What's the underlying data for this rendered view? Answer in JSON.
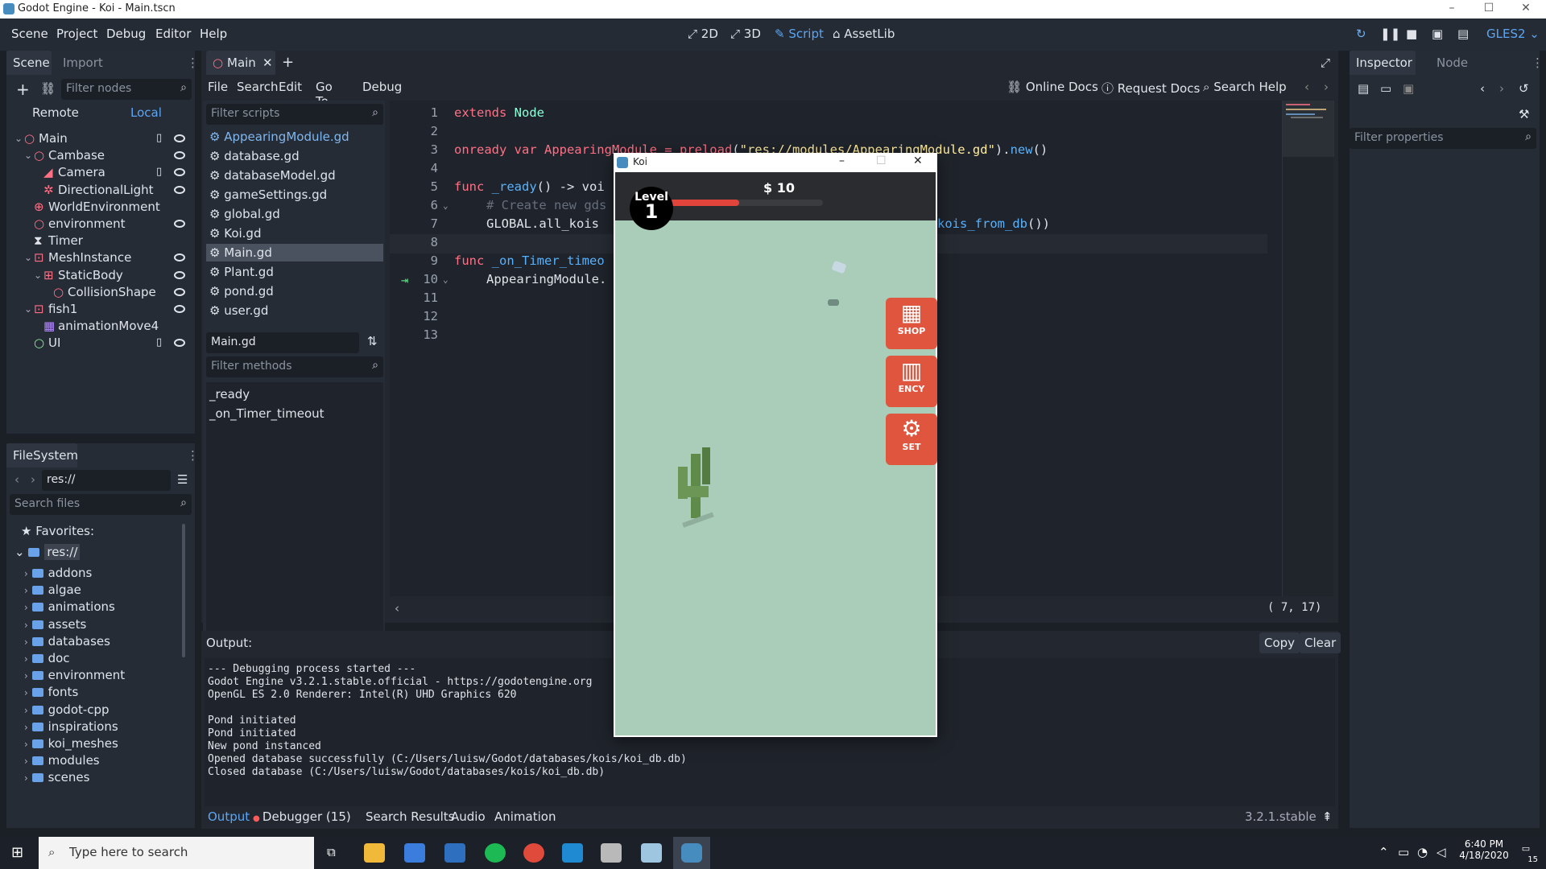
{
  "window": {
    "title": "Godot Engine - Koi - Main.tscn",
    "controls": [
      "–",
      "☐",
      "✕"
    ]
  },
  "menu": {
    "items": [
      "Scene",
      "Project",
      "Debug",
      "Editor",
      "Help"
    ]
  },
  "workspaces": {
    "2d": "2D",
    "3d": "3D",
    "script": "Script",
    "assetlib": "AssetLib"
  },
  "renderer": "GLES2",
  "scene_dock": {
    "tabs": [
      "Scene",
      "Import"
    ],
    "filter_placeholder": "Filter nodes",
    "remote": "Remote",
    "local": "Local",
    "nodes": [
      {
        "label": "Main",
        "depth": 0,
        "icon": "circle-red",
        "script": true,
        "eye": true
      },
      {
        "label": "Cambase",
        "depth": 1,
        "icon": "circle-red",
        "script": false,
        "eye": true
      },
      {
        "label": "Camera",
        "depth": 2,
        "icon": "camera-red",
        "script": true,
        "eye": true
      },
      {
        "label": "DirectionalLight",
        "depth": 2,
        "icon": "light-red",
        "script": false,
        "eye": true
      },
      {
        "label": "WorldEnvironment",
        "depth": 1,
        "icon": "globe-red",
        "script": false,
        "eye": false
      },
      {
        "label": "environment",
        "depth": 1,
        "icon": "circle-red",
        "script": false,
        "eye": true
      },
      {
        "label": "Timer",
        "depth": 1,
        "icon": "hourglass",
        "script": false,
        "eye": false
      },
      {
        "label": "MeshInstance",
        "depth": 1,
        "icon": "mesh-red",
        "script": false,
        "eye": true
      },
      {
        "label": "StaticBody",
        "depth": 2,
        "icon": "body-red",
        "script": false,
        "eye": true
      },
      {
        "label": "CollisionShape",
        "depth": 3,
        "icon": "circle-red",
        "script": false,
        "eye": true
      },
      {
        "label": "fish1",
        "depth": 1,
        "icon": "mesh-red",
        "script": false,
        "eye": true
      },
      {
        "label": "animationMove4",
        "depth": 2,
        "icon": "anim-purple",
        "script": false,
        "eye": false
      },
      {
        "label": "UI",
        "depth": 1,
        "icon": "circle-green",
        "script": true,
        "eye": true
      }
    ]
  },
  "filesystem": {
    "tab": "FileSystem",
    "path": "res://",
    "search_placeholder": "Search files",
    "favorites": "Favorites:",
    "root": "res://",
    "folders": [
      "addons",
      "algae",
      "animations",
      "assets",
      "databases",
      "doc",
      "environment",
      "fonts",
      "godot-cpp",
      "inspirations",
      "koi_meshes",
      "modules",
      "scenes"
    ]
  },
  "script_editor": {
    "tab": "Main",
    "menu": [
      "File",
      "Search",
      "Edit",
      "Go To",
      "Debug"
    ],
    "help_links": [
      "Online Docs",
      "Request Docs",
      "Search Help"
    ],
    "filter_scripts_placeholder": "Filter scripts",
    "scripts": [
      "AppearingModule.gd",
      "database.gd",
      "databaseModel.gd",
      "gameSettings.gd",
      "global.gd",
      "Koi.gd",
      "Main.gd",
      "Plant.gd",
      "pond.gd",
      "user.gd"
    ],
    "current_script": "Main.gd",
    "filter_methods_placeholder": "Filter methods",
    "methods": [
      "_ready",
      "_on_Timer_timeout"
    ],
    "line_numbers": [
      "1",
      "2",
      "3",
      "4",
      "5",
      "6",
      "7",
      "8",
      "9",
      "10",
      "11",
      "12",
      "13"
    ],
    "cursor": "(   7, 17)",
    "code": {
      "l1a": "extends ",
      "l1b": "Node",
      "l3a": "onready var AppearingModule = ",
      "l3b": "preload",
      "l3c": "(",
      "l3d": "\"res://modules/AppearingModule.gd\"",
      "l3e": ").",
      "l3f": "new",
      "l3g": "()",
      "l5a": "func ",
      "l5b": "_ready",
      "l5c": "() -> voi",
      "l6": "# Create new gds",
      "l7a": "GLOBAL.all_kois",
      "l7b": "kois_from_db",
      "l7c": "())",
      "l9a": "func ",
      "l9b": "_on_Timer_timeo",
      "l10": "AppearingModule."
    }
  },
  "output": {
    "label": "Output:",
    "copy": "Copy",
    "clear": "Clear",
    "lines": [
      "--- Debugging process started ---",
      "Godot Engine v3.2.1.stable.official - https://godotengine.org",
      "OpenGL ES 2.0 Renderer: Intel(R) UHD Graphics 620",
      "",
      "Pond initiated",
      "Pond initiated",
      "New pond instanced",
      "Opened database successfully (C:/Users/luisw/Godot/databases/kois/koi_db.db)",
      "Closed database (C:/Users/luisw/Godot/databases/kois/koi_db.db)"
    ],
    "bottom_tabs": [
      "Output",
      "Debugger (15)",
      "Search Results",
      "Audio",
      "Animation"
    ],
    "version": "3.2.1.stable"
  },
  "inspector": {
    "tabs": [
      "Inspector",
      "Node"
    ],
    "filter_placeholder": "Filter properties"
  },
  "game_window": {
    "title": "Koi",
    "level_label": "Level",
    "level_value": "1",
    "money": "$ 10",
    "xp_fraction": 0.45,
    "buttons": [
      "SHOP",
      "ENCY",
      "SET"
    ],
    "colors": {
      "water": "#a9cdb8",
      "hud": "#2a2c30",
      "button": "#e0553d",
      "xp": "#e0443a"
    }
  },
  "taskbar": {
    "search_placeholder": "Type here to search",
    "time": "6:40 PM",
    "date": "4/18/2020",
    "notifications": "15"
  }
}
